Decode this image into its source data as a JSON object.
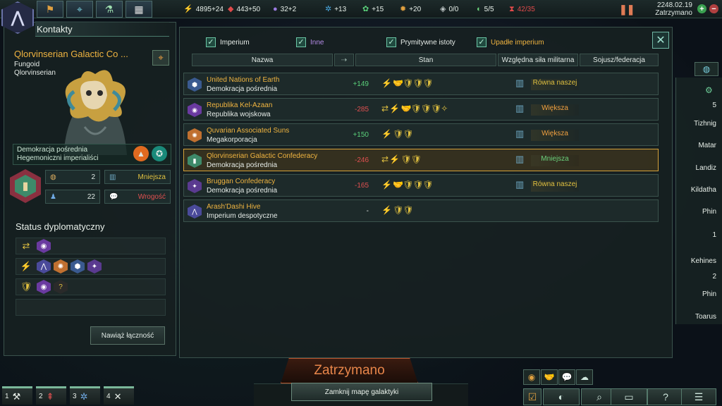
{
  "topbar": {
    "resources": [
      {
        "icon": "energy-icon",
        "glyph": "⚡",
        "color": "#f2c14e",
        "value": "4895+24"
      },
      {
        "icon": "minerals-icon",
        "glyph": "◆",
        "color": "#e04a4a",
        "value": "443+50"
      },
      {
        "icon": "influence-icon",
        "glyph": "●",
        "color": "#9a7ae0",
        "value": "32+2"
      },
      {
        "icon": "physics-research-icon",
        "glyph": "✲",
        "color": "#4aa8e0",
        "value": "+13"
      },
      {
        "icon": "society-research-icon",
        "glyph": "✿",
        "color": "#5ad07a",
        "value": "+15"
      },
      {
        "icon": "engineering-research-icon",
        "glyph": "✹",
        "color": "#e0a040",
        "value": "+20"
      },
      {
        "icon": "strategic-resource-icon",
        "glyph": "◈",
        "color": "#c0c8c8",
        "value": "0/0"
      },
      {
        "icon": "planets-icon",
        "glyph": "◐",
        "color": "#6ad07a",
        "value": "5/5"
      },
      {
        "icon": "fleet-capacity-icon",
        "glyph": "⧗",
        "color": "#e04a4a",
        "value": "42/35"
      }
    ],
    "date": "2248.02.19",
    "status": "Zatrzymano"
  },
  "left": {
    "title": "Kontakty",
    "contact_name": "Qlorvinserian Galactic Co ...",
    "contact_type": "Fungoid",
    "contact_species": "Qlorvinserian",
    "government": "Demokracja pośrednia",
    "ethics": "Hegemoniczni imperialiści",
    "stats": {
      "planets": "2",
      "power": "Mniejsza",
      "pops": "22",
      "attitude": "Wrogość"
    },
    "status_title": "Status dyplomatyczny",
    "connect_button": "Nawiąż łączność"
  },
  "filters": [
    {
      "label": "Imperium",
      "color": "#e5ebe7"
    },
    {
      "label": "Inne",
      "color": "#b48ae6"
    },
    {
      "label": "Prymitywne istoty",
      "color": "#e5ebe7"
    },
    {
      "label": "Upadłe imperium",
      "color": "#f0b440"
    }
  ],
  "columns": {
    "name": "Nazwa",
    "status": "Stan",
    "power": "Względna siła militarna",
    "alliance": "Sojusz/federacja"
  },
  "contacts": [
    {
      "name": "United Nations of Earth",
      "gov": "Demokracja pośrednia",
      "opinion": "+149",
      "status": "⚡ 🤝🛡🛡🛡",
      "power": "Równa naszej",
      "emblem_color": "#3a5a90",
      "glyph": "⬢"
    },
    {
      "name": "Republika Kel-Azaan",
      "gov": "Republika wojskowa",
      "opinion": "-285",
      "status": "⇄ ⚡ 🤝🛡🛡🛡✧",
      "power": "Większa",
      "emblem_color": "#6a3aa0",
      "glyph": "◉"
    },
    {
      "name": "Quvarian Associated Suns",
      "gov": "Megakorporacja",
      "opinion": "+150",
      "status": "⚡ 🛡🛡",
      "power": "Większa",
      "emblem_color": "#c07030",
      "glyph": "✺"
    },
    {
      "name": "Qlorvinserian Galactic Confederacy",
      "gov": "Demokracja pośrednia",
      "opinion": "-246",
      "status": "⇄ ⚡ 🛡🛡",
      "power": "Mniejsza",
      "emblem_color": "#3e8a6a",
      "glyph": "▮"
    },
    {
      "name": "Bruggan Confederacy",
      "gov": "Demokracja pośrednia",
      "opinion": "-165",
      "status": "⚡ 🤝🛡🛡🛡",
      "power": "Równa naszej",
      "emblem_color": "#5a3a90",
      "glyph": "✦"
    },
    {
      "name": "Arash'Dashi Hive",
      "gov": "Imperium despotyczne",
      "opinion": "-",
      "status": "⚡ 🛡🛡",
      "power": "",
      "emblem_color": "#4a4a9a",
      "glyph": "⋀"
    }
  ],
  "right_panel": {
    "items": [
      "5",
      "Tizhnig",
      "Matar",
      "Landiz",
      "Kildatha",
      "Phin",
      "1",
      "Kehines",
      "2",
      "Phin",
      "Toarus"
    ]
  },
  "bottom": {
    "paused": "Zatrzymano",
    "close_map": "Zamknij mapę galaktyki",
    "quick_tabs": [
      "1",
      "2",
      "3",
      "4"
    ]
  }
}
